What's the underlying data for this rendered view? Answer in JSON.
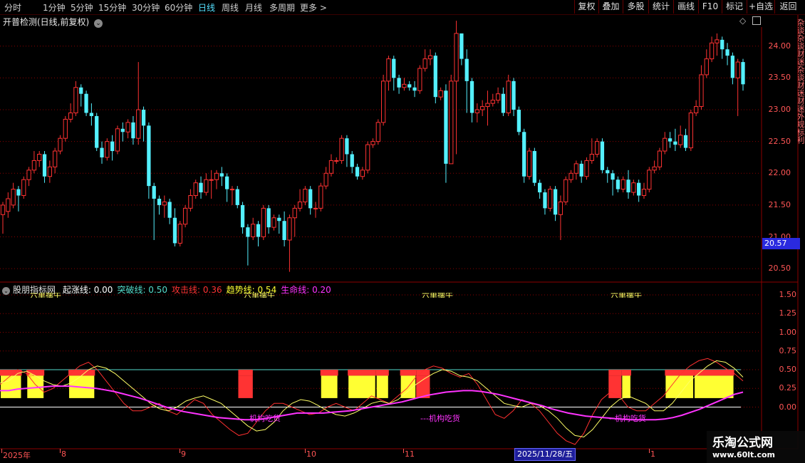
{
  "toolbar": {
    "timeframes": [
      "分时",
      "1分钟",
      "5分钟",
      "15分钟",
      "30分钟",
      "60分钟",
      "日线",
      "周线",
      "月线",
      "多周期",
      "更多 >"
    ],
    "active_timeframe": "日线",
    "buttons": [
      "复权",
      "叠加",
      "多股",
      "统计",
      "画线",
      "F10",
      "标记",
      "+自选",
      "返回"
    ]
  },
  "chart_title": "开普检测(日线,前复权)",
  "price_axis": [
    "24.00",
    "23.50",
    "23.00",
    "22.50",
    "22.00",
    "21.50",
    "21.00",
    "20.50"
  ],
  "current_price": "20.57",
  "indicator": {
    "name": "股朋指标网",
    "lines": [
      {
        "label": "起涨线:",
        "value": "0.00",
        "color": "#ffffff"
      },
      {
        "label": "突破线:",
        "value": "0.50",
        "color": "#55ddcc"
      },
      {
        "label": "攻击线:",
        "value": "0.36",
        "color": "#ff3333"
      },
      {
        "label": "趋势线:",
        "value": "0.54",
        "color": "#ffff33"
      },
      {
        "label": "生命线:",
        "value": "0.20",
        "color": "#ff33ff"
      }
    ],
    "axis": [
      "1.50",
      "1.25",
      "1.00",
      "0.75",
      "0.50",
      "0.25",
      "0.00"
    ],
    "annotations": [
      "机构吃货",
      "---机构吃货",
      "--机构吃货"
    ],
    "top_labels": [
      "六单擒牛",
      "六单擒牛",
      "六单擒牛",
      "六单擒牛"
    ]
  },
  "date_axis": [
    "2025年",
    "8",
    "9",
    "10",
    "11",
    "1"
  ],
  "selected_date": "2025/11/28/五",
  "side_text": "杂谈杂谈财迷杂谈财迷财迷外规标利",
  "watermark": {
    "title": "乐淘公式网",
    "url": "www.60lt.com"
  },
  "colors": {
    "up": "#ff3232",
    "down": "#54f0ff",
    "grid": "#8b0000",
    "accent": "#55e0ff",
    "life": "#ff33ff",
    "trend": "#ffff33",
    "attack": "#ff3333"
  },
  "chart_data": {
    "type": "candlestick",
    "ylim": [
      20.3,
      24.3
    ],
    "candles": [
      [
        21.35,
        21.5,
        21.05,
        21.55
      ],
      [
        21.4,
        21.6,
        21.3,
        21.7
      ],
      [
        21.5,
        21.75,
        21.45,
        21.85
      ],
      [
        21.75,
        21.65,
        21.4,
        21.8
      ],
      [
        21.65,
        21.9,
        21.6,
        21.95
      ],
      [
        21.9,
        22.05,
        21.8,
        22.1
      ],
      [
        22.05,
        22.2,
        22.0,
        22.35
      ],
      [
        22.2,
        22.3,
        22.1,
        22.35
      ],
      [
        22.3,
        21.95,
        21.85,
        22.35
      ],
      [
        21.95,
        22.1,
        21.85,
        22.2
      ],
      [
        22.1,
        22.35,
        22.0,
        22.4
      ],
      [
        22.35,
        22.55,
        22.3,
        22.6
      ],
      [
        22.55,
        22.85,
        22.5,
        22.9
      ],
      [
        22.85,
        22.95,
        22.8,
        23.1
      ],
      [
        22.95,
        23.35,
        22.9,
        23.45
      ],
      [
        23.35,
        23.25,
        23.05,
        23.4
      ],
      [
        23.25,
        22.95,
        22.9,
        23.3
      ],
      [
        22.95,
        22.9,
        22.75,
        23.1
      ],
      [
        22.9,
        22.4,
        22.35,
        22.95
      ],
      [
        22.4,
        22.25,
        22.15,
        22.5
      ],
      [
        22.25,
        22.5,
        22.2,
        22.55
      ],
      [
        22.5,
        22.35,
        22.2,
        22.6
      ],
      [
        22.35,
        22.7,
        22.3,
        22.75
      ],
      [
        22.7,
        22.65,
        22.5,
        22.8
      ],
      [
        22.65,
        22.8,
        22.55,
        22.85
      ],
      [
        22.8,
        22.55,
        22.45,
        22.9
      ],
      [
        22.55,
        23.0,
        22.45,
        23.75
      ],
      [
        23.0,
        22.75,
        22.5,
        23.05
      ],
      [
        22.75,
        21.8,
        21.6,
        22.8
      ],
      [
        21.8,
        21.6,
        20.95,
        21.85
      ],
      [
        21.6,
        21.5,
        21.35,
        21.65
      ],
      [
        21.5,
        21.55,
        21.3,
        21.65
      ],
      [
        21.55,
        21.3,
        21.2,
        21.6
      ],
      [
        21.3,
        20.9,
        20.85,
        21.45
      ],
      [
        20.9,
        21.2,
        20.85,
        21.25
      ],
      [
        21.2,
        21.45,
        21.15,
        21.5
      ],
      [
        21.45,
        21.65,
        21.4,
        21.75
      ],
      [
        21.65,
        21.85,
        21.6,
        21.9
      ],
      [
        21.85,
        21.7,
        21.6,
        21.95
      ],
      [
        21.7,
        21.9,
        21.65,
        22.0
      ],
      [
        21.9,
        21.9,
        21.6,
        22.05
      ],
      [
        21.9,
        22.0,
        21.75,
        22.05
      ],
      [
        22.0,
        21.95,
        21.8,
        22.1
      ],
      [
        21.95,
        21.75,
        21.55,
        22.0
      ],
      [
        21.75,
        21.75,
        21.5,
        21.8
      ],
      [
        21.75,
        21.5,
        21.45,
        21.8
      ],
      [
        21.5,
        21.15,
        21.05,
        21.55
      ],
      [
        21.15,
        21.0,
        20.55,
        21.2
      ],
      [
        21.0,
        21.2,
        20.95,
        21.3
      ],
      [
        21.2,
        21.0,
        20.85,
        21.25
      ],
      [
        21.0,
        21.45,
        20.95,
        21.5
      ],
      [
        21.45,
        21.15,
        21.05,
        21.5
      ],
      [
        21.15,
        21.3,
        21.1,
        21.35
      ],
      [
        21.3,
        21.25,
        21.05,
        21.35
      ],
      [
        21.25,
        20.95,
        20.85,
        21.4
      ],
      [
        20.95,
        21.3,
        20.45,
        21.35
      ],
      [
        21.3,
        21.45,
        21.0,
        21.5
      ],
      [
        21.45,
        21.55,
        21.4,
        21.75
      ],
      [
        21.55,
        21.75,
        21.5,
        21.8
      ],
      [
        21.75,
        21.45,
        21.35,
        21.8
      ],
      [
        21.45,
        21.45,
        21.3,
        21.55
      ],
      [
        21.45,
        21.8,
        21.4,
        21.85
      ],
      [
        21.8,
        22.0,
        21.75,
        22.1
      ],
      [
        22.0,
        22.2,
        21.95,
        22.3
      ],
      [
        22.2,
        22.2,
        22.15,
        22.25
      ],
      [
        22.2,
        22.55,
        22.15,
        22.6
      ],
      [
        22.55,
        22.3,
        22.1,
        22.6
      ],
      [
        22.3,
        22.1,
        22.0,
        22.35
      ],
      [
        22.1,
        21.95,
        21.9,
        22.15
      ],
      [
        21.95,
        22.05,
        21.9,
        22.1
      ],
      [
        22.05,
        22.45,
        22.0,
        22.5
      ],
      [
        22.45,
        22.5,
        22.4,
        22.55
      ],
      [
        22.5,
        22.8,
        22.45,
        22.85
      ],
      [
        22.8,
        23.45,
        22.75,
        23.55
      ],
      [
        23.45,
        23.8,
        23.3,
        23.85
      ],
      [
        23.8,
        23.5,
        23.3,
        23.85
      ],
      [
        23.5,
        23.35,
        23.25,
        23.55
      ],
      [
        23.35,
        23.4,
        23.3,
        23.5
      ],
      [
        23.4,
        23.35,
        23.3,
        23.45
      ],
      [
        23.35,
        23.3,
        23.2,
        23.45
      ],
      [
        23.3,
        23.65,
        23.25,
        23.7
      ],
      [
        23.65,
        23.8,
        23.6,
        23.95
      ],
      [
        23.8,
        23.85,
        23.7,
        23.95
      ],
      [
        23.85,
        23.2,
        23.1,
        23.9
      ],
      [
        23.2,
        23.3,
        23.15,
        23.35
      ],
      [
        23.3,
        22.15,
        21.85,
        23.4
      ],
      [
        22.15,
        23.45,
        22.25,
        23.55
      ],
      [
        23.45,
        24.2,
        22.3,
        24.4
      ],
      [
        24.2,
        23.8,
        23.7,
        24.05
      ],
      [
        23.8,
        23.45,
        22.95,
        23.95
      ],
      [
        23.45,
        22.95,
        22.8,
        23.5
      ],
      [
        22.95,
        23.0,
        22.8,
        23.1
      ],
      [
        23.0,
        23.05,
        22.9,
        23.15
      ],
      [
        23.05,
        23.1,
        22.75,
        23.3
      ],
      [
        23.1,
        23.15,
        23.05,
        23.25
      ],
      [
        23.15,
        23.25,
        23.1,
        23.35
      ],
      [
        23.25,
        22.95,
        22.9,
        23.35
      ],
      [
        22.95,
        23.45,
        22.9,
        23.55
      ],
      [
        23.45,
        23.0,
        22.9,
        23.5
      ],
      [
        23.0,
        22.65,
        22.6,
        23.05
      ],
      [
        22.65,
        21.95,
        21.85,
        22.7
      ],
      [
        21.95,
        22.35,
        21.9,
        22.4
      ],
      [
        22.35,
        21.85,
        21.8,
        22.4
      ],
      [
        21.85,
        21.7,
        21.6,
        21.9
      ],
      [
        21.7,
        21.45,
        21.35,
        21.75
      ],
      [
        21.45,
        21.75,
        21.4,
        21.8
      ],
      [
        21.75,
        21.35,
        21.25,
        21.8
      ],
      [
        21.35,
        21.55,
        20.95,
        21.65
      ],
      [
        21.55,
        21.9,
        21.5,
        21.95
      ],
      [
        21.9,
        22.0,
        21.85,
        22.05
      ],
      [
        22.0,
        22.15,
        21.9,
        22.2
      ],
      [
        22.15,
        21.95,
        21.85,
        22.2
      ],
      [
        21.95,
        22.2,
        21.9,
        22.25
      ],
      [
        22.2,
        22.3,
        22.15,
        22.55
      ],
      [
        22.3,
        22.5,
        22.25,
        22.55
      ],
      [
        22.5,
        22.05,
        22.0,
        22.55
      ],
      [
        22.05,
        22.0,
        21.85,
        22.1
      ],
      [
        22.0,
        21.9,
        21.65,
        22.05
      ],
      [
        21.9,
        21.75,
        21.7,
        21.95
      ],
      [
        21.75,
        21.9,
        21.7,
        21.95
      ],
      [
        21.9,
        21.7,
        21.6,
        22.05
      ],
      [
        21.7,
        21.85,
        21.65,
        21.9
      ],
      [
        21.85,
        21.65,
        21.55,
        21.9
      ],
      [
        21.65,
        21.75,
        21.6,
        21.85
      ],
      [
        21.75,
        22.05,
        21.7,
        22.1
      ],
      [
        22.05,
        22.1,
        22.0,
        22.2
      ],
      [
        22.1,
        22.35,
        22.05,
        22.4
      ],
      [
        22.35,
        22.55,
        22.3,
        22.65
      ],
      [
        22.55,
        22.5,
        22.4,
        22.65
      ],
      [
        22.5,
        22.45,
        22.35,
        22.7
      ],
      [
        22.45,
        22.6,
        22.4,
        22.75
      ],
      [
        22.6,
        22.4,
        22.35,
        22.7
      ],
      [
        22.4,
        22.95,
        22.35,
        23.0
      ],
      [
        22.95,
        23.05,
        22.9,
        23.15
      ],
      [
        23.05,
        23.55,
        23.0,
        23.7
      ],
      [
        23.55,
        23.8,
        23.5,
        23.95
      ],
      [
        23.8,
        24.05,
        23.75,
        24.15
      ],
      [
        24.05,
        24.1,
        23.85,
        24.2
      ],
      [
        24.1,
        23.95,
        23.8,
        24.15
      ],
      [
        23.95,
        23.85,
        23.7,
        24.05
      ],
      [
        23.85,
        23.5,
        23.4,
        23.9
      ],
      [
        23.5,
        23.75,
        22.9,
        23.8
      ],
      [
        23.75,
        23.4,
        23.3,
        23.8
      ]
    ],
    "indicator_series": {
      "yellow": [
        0.32,
        0.35,
        0.45,
        0.48,
        0.42,
        0.35,
        0.3,
        0.28,
        0.32,
        0.4,
        0.5,
        0.55,
        0.52,
        0.45,
        0.35,
        0.25,
        0.15,
        0.05,
        -0.02,
        -0.05,
        0.0,
        0.08,
        0.12,
        0.15,
        0.1,
        0.05,
        -0.05,
        -0.15,
        -0.25,
        -0.32,
        -0.3,
        -0.2,
        -0.05,
        0.05,
        0.1,
        0.08,
        0.02,
        -0.05,
        -0.1,
        -0.12,
        -0.08,
        -0.02,
        0.05,
        0.08,
        0.05,
        0.1,
        0.2,
        0.3,
        0.38,
        0.45,
        0.5,
        0.48,
        0.42,
        0.4,
        0.35,
        0.25,
        0.15,
        0.05,
        0.02,
        0.0,
        0.05,
        0.02,
        -0.05,
        -0.15,
        -0.28,
        -0.38,
        -0.4,
        -0.3,
        -0.15,
        0.0,
        0.1,
        0.15,
        0.1,
        0.05,
        -0.05,
        -0.05,
        0.05,
        0.2,
        0.35,
        0.45,
        0.55,
        0.62,
        0.6,
        0.52,
        0.4
      ],
      "red": [
        0.3,
        0.4,
        0.5,
        0.45,
        0.3,
        0.2,
        0.25,
        0.35,
        0.45,
        0.55,
        0.6,
        0.5,
        0.35,
        0.2,
        0.05,
        -0.05,
        -0.05,
        0.0,
        0.05,
        -0.05,
        -0.1,
        0.0,
        0.1,
        0.05,
        -0.1,
        -0.2,
        -0.3,
        -0.38,
        -0.35,
        -0.2,
        -0.05,
        0.05,
        0.05,
        0.0,
        -0.05,
        -0.1,
        -0.08,
        0.0,
        0.05,
        0.0,
        -0.05,
        0.05,
        0.15,
        0.1,
        0.05,
        0.15,
        0.25,
        0.4,
        0.5,
        0.55,
        0.52,
        0.45,
        0.4,
        0.45,
        0.3,
        0.1,
        -0.1,
        -0.15,
        -0.05,
        0.1,
        0.05,
        -0.05,
        -0.2,
        -0.35,
        -0.45,
        -0.5,
        -0.35,
        -0.1,
        0.1,
        0.2,
        0.15,
        0.0,
        -0.05,
        -0.05,
        0.05,
        0.15,
        0.3,
        0.45,
        0.55,
        0.62,
        0.65,
        0.6,
        0.52,
        0.45,
        0.35
      ],
      "life": [
        0.22,
        0.22,
        0.24,
        0.25,
        0.26,
        0.27,
        0.28,
        0.28,
        0.28,
        0.27,
        0.26,
        0.25,
        0.23,
        0.21,
        0.18,
        0.15,
        0.12,
        0.08,
        0.04,
        0.0,
        -0.03,
        -0.06,
        -0.08,
        -0.1,
        -0.12,
        -0.14,
        -0.15,
        -0.16,
        -0.17,
        -0.17,
        -0.16,
        -0.14,
        -0.12,
        -0.1,
        -0.08,
        -0.08,
        -0.08,
        -0.08,
        -0.07,
        -0.06,
        -0.05,
        -0.03,
        -0.01,
        0.01,
        0.03,
        0.05,
        0.07,
        0.1,
        0.13,
        0.16,
        0.18,
        0.2,
        0.21,
        0.22,
        0.22,
        0.21,
        0.19,
        0.17,
        0.14,
        0.11,
        0.08,
        0.05,
        0.02,
        -0.02,
        -0.05,
        -0.08,
        -0.1,
        -0.12,
        -0.13,
        -0.14,
        -0.15,
        -0.16,
        -0.17,
        -0.17,
        -0.17,
        -0.17,
        -0.16,
        -0.14,
        -0.11,
        -0.07,
        -0.03,
        0.02,
        0.07,
        0.12,
        0.17,
        0.2
      ]
    },
    "blocks": [
      {
        "i0": 0.0,
        "i1": 0.027,
        "type": "ry"
      },
      {
        "i0": 0.033,
        "i1": 0.055,
        "type": "ry"
      },
      {
        "i0": 0.085,
        "i1": 0.118,
        "type": "ry"
      },
      {
        "i0": 0.296,
        "i1": 0.314,
        "type": "r"
      },
      {
        "i0": 0.398,
        "i1": 0.42,
        "type": "ry"
      },
      {
        "i0": 0.432,
        "i1": 0.467,
        "type": "ry"
      },
      {
        "i0": 0.467,
        "i1": 0.483,
        "type": "ry"
      },
      {
        "i0": 0.497,
        "i1": 0.517,
        "type": "ry"
      },
      {
        "i0": 0.517,
        "i1": 0.534,
        "type": "r"
      },
      {
        "i0": 0.756,
        "i1": 0.772,
        "type": "r"
      },
      {
        "i0": 0.772,
        "i1": 0.784,
        "type": "ry"
      },
      {
        "i0": 0.826,
        "i1": 0.862,
        "type": "ry"
      },
      {
        "i0": 0.862,
        "i1": 0.912,
        "type": "ry"
      }
    ]
  }
}
